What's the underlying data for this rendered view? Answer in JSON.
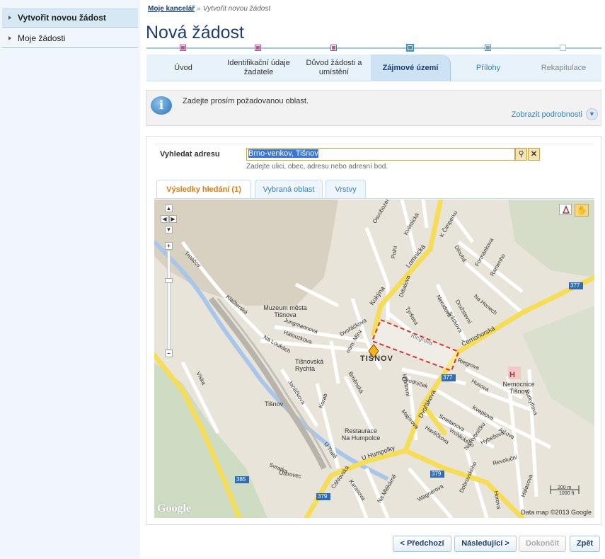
{
  "sidebar": {
    "items": [
      {
        "label": "Vytvořit novou žádost",
        "active": true
      },
      {
        "label": "Moje žádosti",
        "active": false
      }
    ]
  },
  "breadcrumb": {
    "home": "Moje kancelář",
    "separator": "»",
    "current": "Vytvořit novou žádost"
  },
  "page": {
    "title": "Nová žádost"
  },
  "wizard": {
    "steps": [
      {
        "label": "Úvod",
        "state": "done"
      },
      {
        "label": "Identifikační údaje žadatele",
        "state": "done"
      },
      {
        "label": "Důvod žádosti a umístění",
        "state": "done"
      },
      {
        "label": "Zájmové území",
        "state": "current"
      },
      {
        "label": "Přílohy",
        "state": "future"
      },
      {
        "label": "Rekapitulace",
        "state": "future"
      }
    ]
  },
  "info": {
    "text": "Zadejte prosím požadovanou oblast.",
    "more_link": "Zobrazit podrobnosti",
    "icon": "info-icon",
    "toggle_icon": "chevron-down-icon"
  },
  "search": {
    "label": "Vyhledat adresu",
    "value": "Brno-venkov, Tišnov",
    "hint": "Zadejte ulici, obec, adresu nebo adresní bod.",
    "find_icon": "magnifier-icon",
    "clear_icon": "close-icon"
  },
  "tabs": [
    {
      "label": "Výsledky hledání (1)",
      "active": true
    },
    {
      "label": "Vybraná oblast",
      "active": false
    },
    {
      "label": "Vrstvy",
      "active": false
    }
  ],
  "map": {
    "town_label": "TIŠNOV",
    "copyright": "Data map ©2013 Google",
    "provider": "Google",
    "scale": [
      "200 m",
      "1000 ft"
    ],
    "zoom_in": "+",
    "zoom_out": "−",
    "tools": [
      "polygon-tool-icon",
      "hand-pan-icon"
    ],
    "labels": {
      "museum": "Muzeum města Tišnova",
      "rychta": "Tišnovská Rychta",
      "station": "Tišnov",
      "hospital": "Nemocnice Tišnov",
      "restaurant": "Restaurace Na Humpolce",
      "lomnicka": "Lomnická",
      "cernohorska": "Černohorská",
      "dvorakova": "Dvořákova",
      "u_humpolky": "U Humpolky",
      "riegrova": "Riegrova",
      "kukyna": "Kukýna",
      "halouzkova": "Halouzkova",
      "jungmannova": "Jungmannova",
      "na_loukach": "Na Loukách",
      "klasterska": "Klášterská",
      "trnacov": "Trnáčov",
      "vista": "Víska",
      "humpolce": "Humpolce",
      "svratka": "Svratka",
      "ostrovec": "Ostrovec",
      "mlyn_377": "377",
      "road_379": "379",
      "road_385": "385",
      "hospital_h": "H",
      "chodnicek": "Chodníček",
      "husova": "Husova",
      "majorova": "Majorova",
      "smetanova": "Smetanova",
      "kveplova": "Kveplova",
      "alsova": "Alšova",
      "hybesova": "Hybešova",
      "revolucni": "Revoluční",
      "purkynova": "Purkyňova",
      "brnenska": "Brněnská",
      "janackova": "Janáčkova",
      "korab": "Korab",
      "na_honech": "Na Honech",
      "druzstevni": "Družstevní",
      "jiraskova": "Jiráskova",
      "nerudova": "Nerudova",
      "tyrsova": "Tyršova",
      "drbalova": "Drbalova",
      "dlouha": "Dlouhá",
      "formankova": "Formánkova",
      "ramenho": "Ramenho",
      "k_cimperku": "K Čimperku",
      "kvetnicka": "Květnická",
      "osvobozeni": "Osvobození",
      "polni": "Polní",
      "dvorackova": "Dvořáčkova",
      "nam_miru": "nám. Míru",
      "u_trati": "U Tratě",
      "karasova": "Karasova",
      "na_mlekarne": "Na Mlékárně",
      "wagnerova": "Wagnerova",
      "cahlovska": "Cáhlovská",
      "horova": "Horova",
      "halasova": "Halasova",
      "dobrovskeho": "Dobrovského",
      "vrchlickeho": "Vrchlického",
      "havlickova": "Havlíčkova",
      "na_rybnicku": "Na Rybníčku",
      "hrbitovni": "Hřbitovní",
      "nerudova2": "Nerudova",
      "stanciho": "Riegrova"
    }
  },
  "buttons": {
    "prev": "< Předchozí",
    "next": "Následující >",
    "finish": "Dokončit",
    "back": "Zpět"
  },
  "colors": {
    "accent": "#1f3d6e",
    "link": "#3a7fb7",
    "active_tab": "#e07a11",
    "area_border": "#d9302a",
    "major_road": "#f5dd5a",
    "water": "#a7c6ea"
  }
}
